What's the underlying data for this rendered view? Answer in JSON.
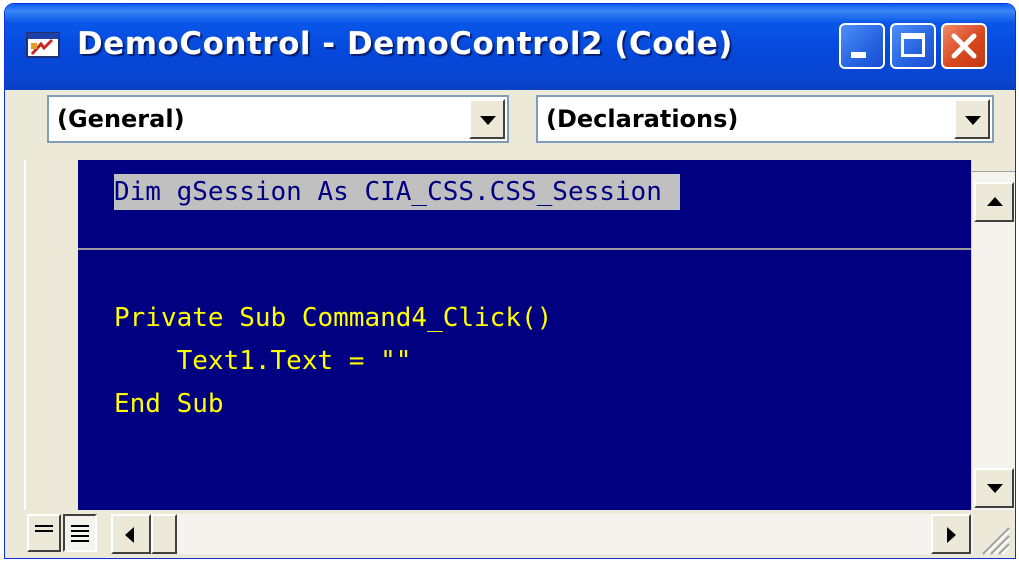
{
  "window": {
    "title": "DemoControl - DemoControl2 (Code)",
    "icon": "vb-code-window-icon",
    "controls": [
      "minimize-icon",
      "maximize-icon",
      "close-icon"
    ]
  },
  "toolbar": {
    "object_combo": {
      "selected": "(General)"
    },
    "procedure_combo": {
      "selected": "(Declarations)"
    }
  },
  "code": {
    "declarations": [
      "Dim gSession As CIA_CSS.CSS_Session"
    ],
    "procedure": [
      "Private Sub Command4_Click()",
      "    Text1.Text = \"\"",
      "End Sub"
    ]
  },
  "colors": {
    "editor_background": "#000080",
    "code_text": "#ffff00",
    "selection_background": "#c0c0c0",
    "title_bar": "#0a46d1",
    "close_button": "#d9471e"
  }
}
